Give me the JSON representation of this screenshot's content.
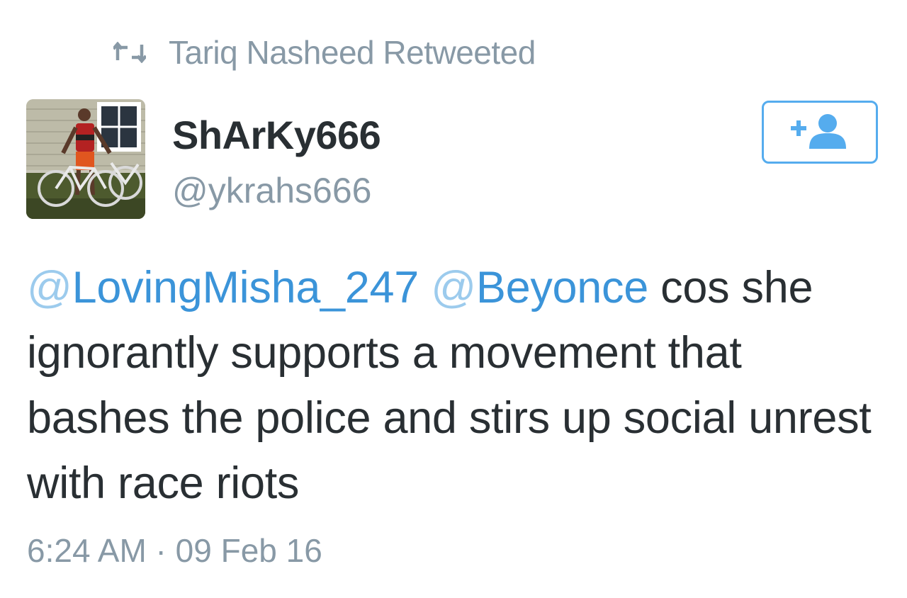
{
  "retweet_banner": {
    "icon": "retweet-icon",
    "text": "Tariq Nasheed Retweeted"
  },
  "author": {
    "display_name": "ShArKy666",
    "handle": "@ykrahs666",
    "avatar": "avatar-photo"
  },
  "follow_button": {
    "icon": "follow-user-icon"
  },
  "tweet": {
    "mention_1": {
      "at": "@",
      "name": "LovingMisha_247"
    },
    "mention_2": {
      "at": "@",
      "name": "Beyonce"
    },
    "body_text": " cos she ignorantly supports a movement that bashes the police and stirs up social unrest with race riots",
    "timestamp": "6:24 AM · 09 Feb 16"
  },
  "colors": {
    "link": "#3b94d9",
    "secondary_text": "#8899a6",
    "primary_text": "#292f33",
    "button_border": "#55acee"
  }
}
